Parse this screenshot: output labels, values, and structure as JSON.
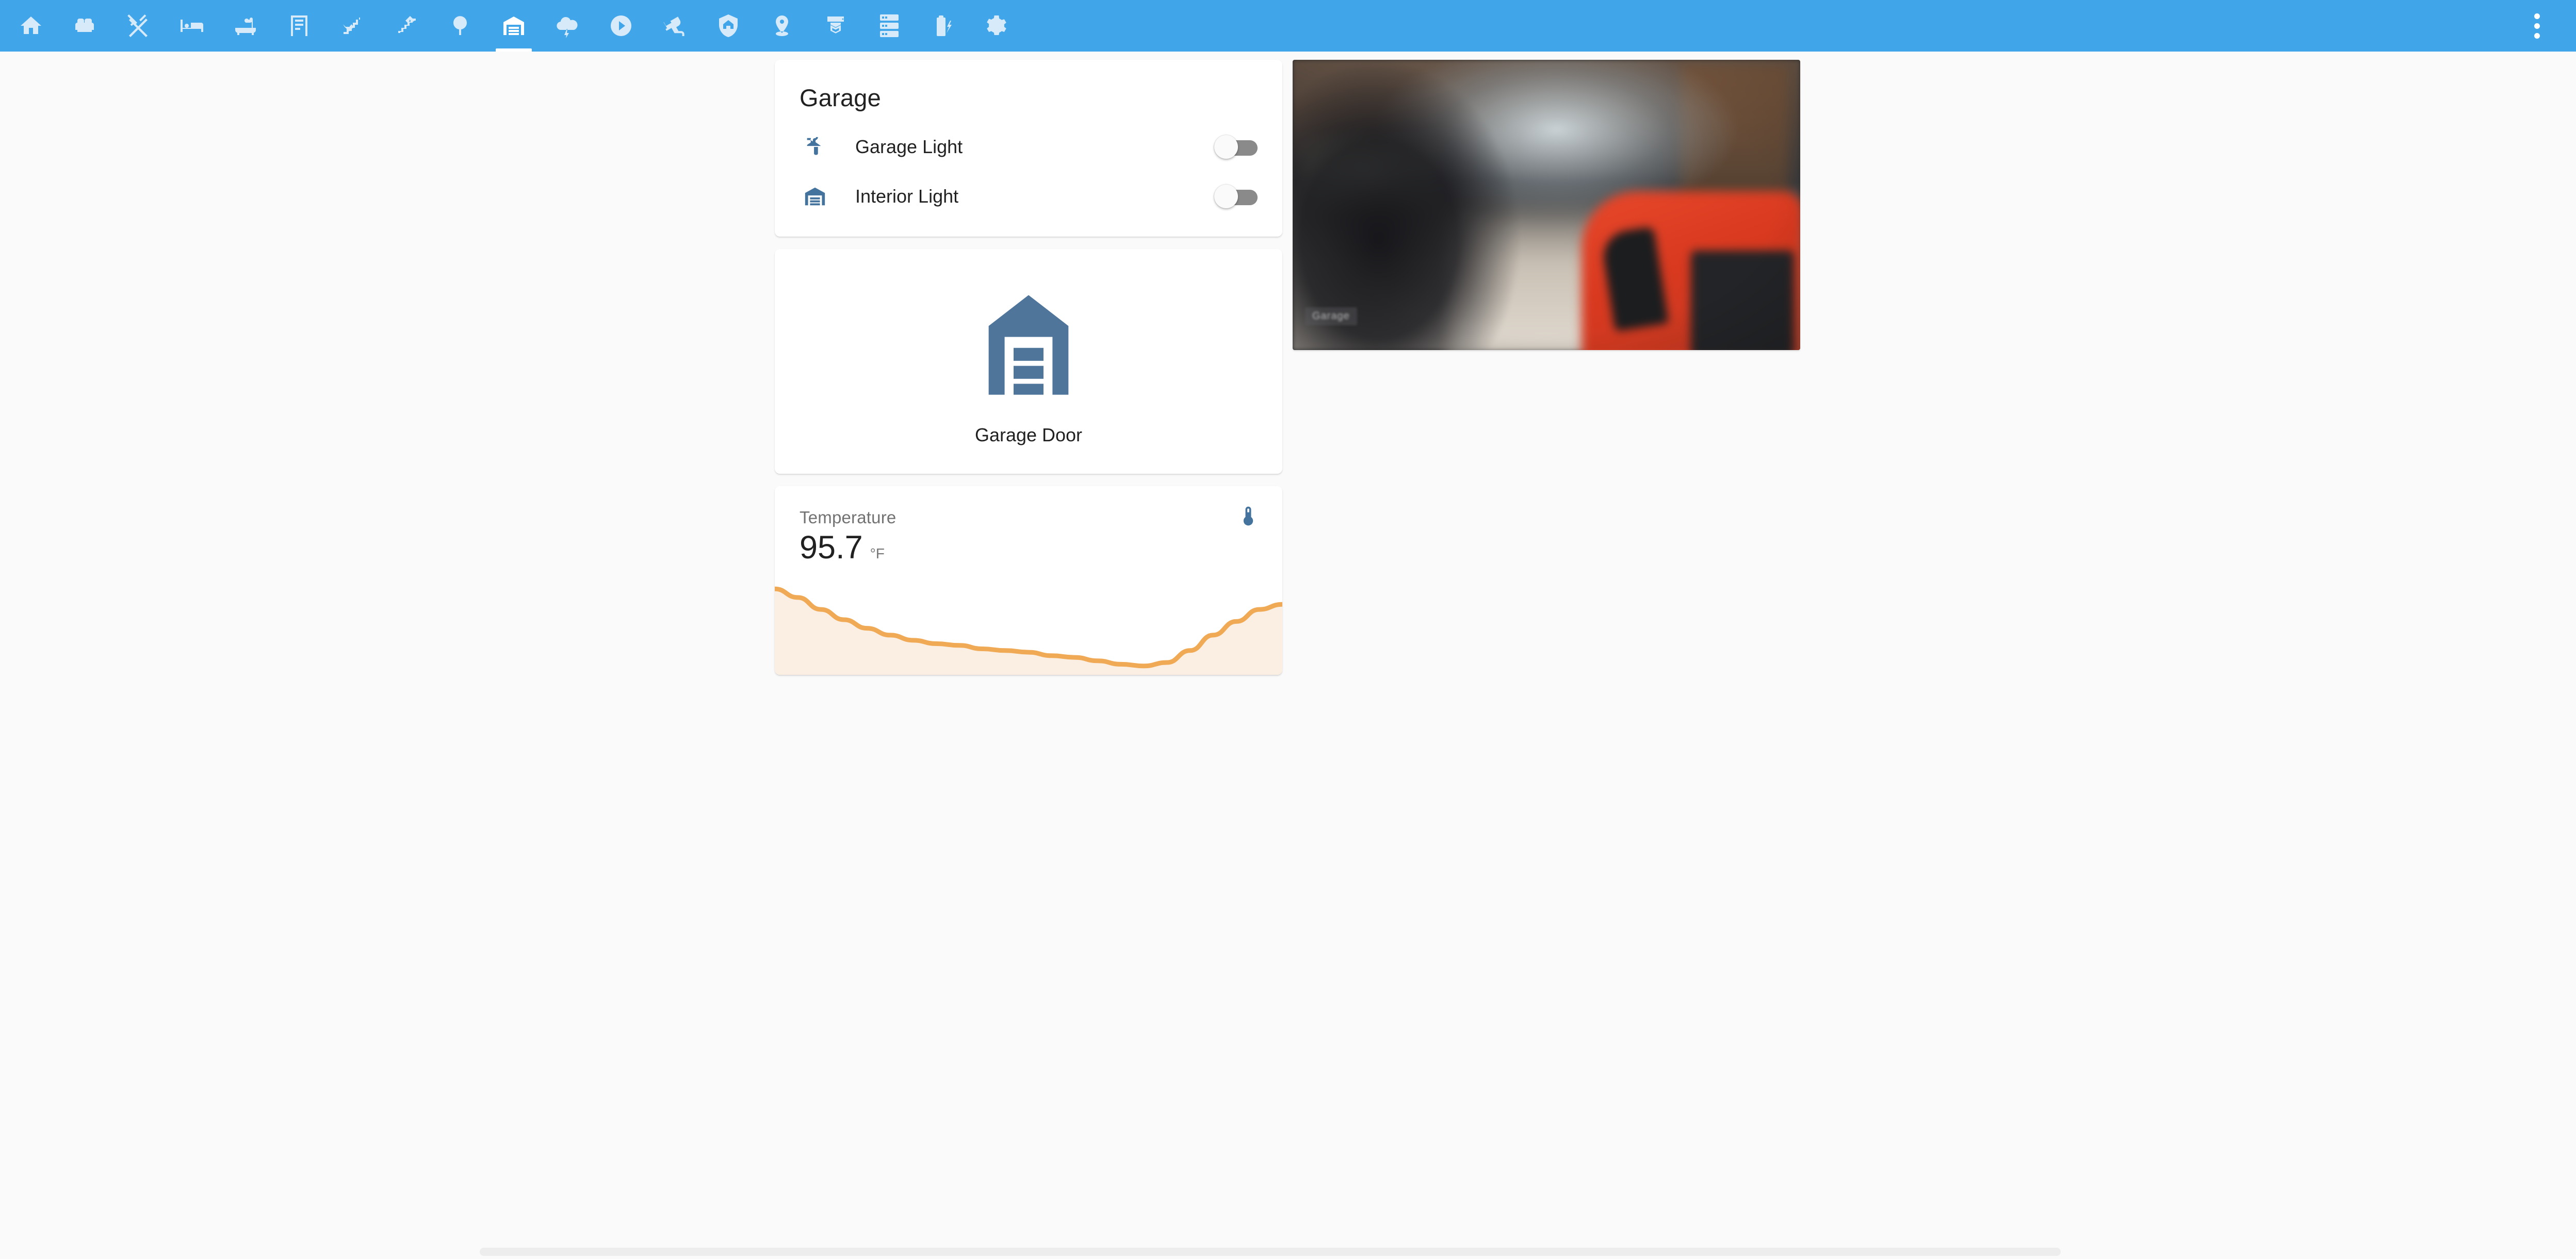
{
  "app": {
    "header_color": "#41a5ea",
    "accent_icon_color": "#44739e",
    "sparkline_color": "#f0a954",
    "sparkline_fill": "#fbefe3"
  },
  "header": {
    "overflow_menu_label": "dots-vertical-icon",
    "tabs": [
      {
        "id": "home",
        "icon": "home-icon",
        "label": "Home",
        "selected": false
      },
      {
        "id": "living",
        "icon": "sofa-icon",
        "label": "Living Room",
        "selected": false
      },
      {
        "id": "kitchen",
        "icon": "silverware-fork-knife-icon",
        "label": "Kitchen",
        "selected": false
      },
      {
        "id": "bedroom",
        "icon": "bed-icon",
        "label": "Bedroom",
        "selected": false
      },
      {
        "id": "bathroom",
        "icon": "bathtub-icon",
        "label": "Bathroom",
        "selected": false
      },
      {
        "id": "office",
        "icon": "bookshelf-icon",
        "label": "Office",
        "selected": false
      },
      {
        "id": "downstairs",
        "icon": "stairs-down-icon",
        "label": "Downstairs",
        "selected": false
      },
      {
        "id": "upstairs",
        "icon": "stairs-up-icon",
        "label": "Upstairs",
        "selected": false
      },
      {
        "id": "outside",
        "icon": "tree-icon",
        "label": "Outside",
        "selected": false
      },
      {
        "id": "garage",
        "icon": "garage-icon",
        "label": "Garage",
        "selected": true
      },
      {
        "id": "weather",
        "icon": "weather-lightning-icon",
        "label": "Weather",
        "selected": false
      },
      {
        "id": "media",
        "icon": "play-circle-icon",
        "label": "Media",
        "selected": false
      },
      {
        "id": "cameras",
        "icon": "cctv-icon",
        "label": "Cameras",
        "selected": false
      },
      {
        "id": "security",
        "icon": "shield-home-icon",
        "label": "Security",
        "selected": false
      },
      {
        "id": "location",
        "icon": "map-marker-icon",
        "label": "Location",
        "selected": false
      },
      {
        "id": "printer3d",
        "icon": "printer-3d-icon",
        "label": "3D Printer",
        "selected": false
      },
      {
        "id": "system",
        "icon": "server-icon",
        "label": "System",
        "selected": false
      },
      {
        "id": "battery",
        "icon": "battery-charging-icon",
        "label": "Batteries",
        "selected": false
      },
      {
        "id": "settings",
        "icon": "cog-icon",
        "label": "Settings",
        "selected": false
      }
    ]
  },
  "entities_card": {
    "title": "Garage",
    "rows": [
      {
        "icon": "wall-sconce-light-icon",
        "name": "Garage Light",
        "toggle_state": "off"
      },
      {
        "icon": "garage-icon",
        "name": "Interior Light",
        "toggle_state": "off"
      }
    ]
  },
  "button_card": {
    "icon": "garage-closed-icon",
    "label": "Garage Door"
  },
  "sensor_card": {
    "label": "Temperature",
    "value": "95.7",
    "unit": "°F",
    "icon": "thermometer-icon"
  },
  "camera_card": {
    "name": "Garage",
    "overlay_badge": "Garage"
  },
  "chart_data": {
    "type": "area",
    "title": "Temperature",
    "ylabel": "°F",
    "series": [
      {
        "name": "Temperature",
        "values": [
          96.6,
          96.1,
          95.4,
          94.8,
          94.3,
          93.9,
          93.6,
          93.4,
          93.3,
          93.1,
          93.0,
          92.9,
          92.7,
          92.6,
          92.4,
          92.2,
          92.1,
          92.3,
          93.0,
          93.9,
          94.7,
          95.4,
          95.7
        ]
      }
    ],
    "x": [
      0,
      1,
      2,
      3,
      4,
      5,
      6,
      7,
      8,
      9,
      10,
      11,
      12,
      13,
      14,
      15,
      16,
      17,
      18,
      19,
      20,
      21,
      22
    ],
    "ylim": [
      92.0,
      97.0
    ],
    "grid": false,
    "legend": "none"
  },
  "scrollbar": {
    "orientation": "horizontal"
  }
}
